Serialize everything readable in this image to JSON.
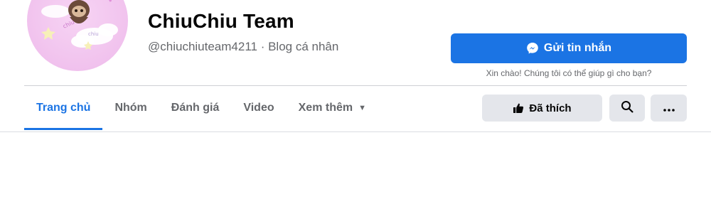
{
  "page": {
    "name": "ChiuChiu Team",
    "handle_category": "@chiuchiuteam4211 · Blog cá nhân"
  },
  "message": {
    "button_label": "Gửi tin nhắn",
    "greeting": "Xin chào! Chúng tôi có thể giúp gì cho bạn?",
    "icon": "messenger-icon"
  },
  "tabs": [
    {
      "label": "Trang chủ",
      "active": true
    },
    {
      "label": "Nhóm",
      "active": false
    },
    {
      "label": "Đánh giá",
      "active": false
    },
    {
      "label": "Video",
      "active": false
    },
    {
      "label": "Xem thêm",
      "active": false
    }
  ],
  "actions": {
    "liked_label": "Đã thích",
    "liked_icon": "thumbs-up-icon",
    "search_icon": "search-icon",
    "more_icon": "more-icon"
  },
  "colors": {
    "accent": "#1b74e4",
    "button_gray": "#e4e6eb",
    "avatar_bg": "#f2c6ef"
  }
}
